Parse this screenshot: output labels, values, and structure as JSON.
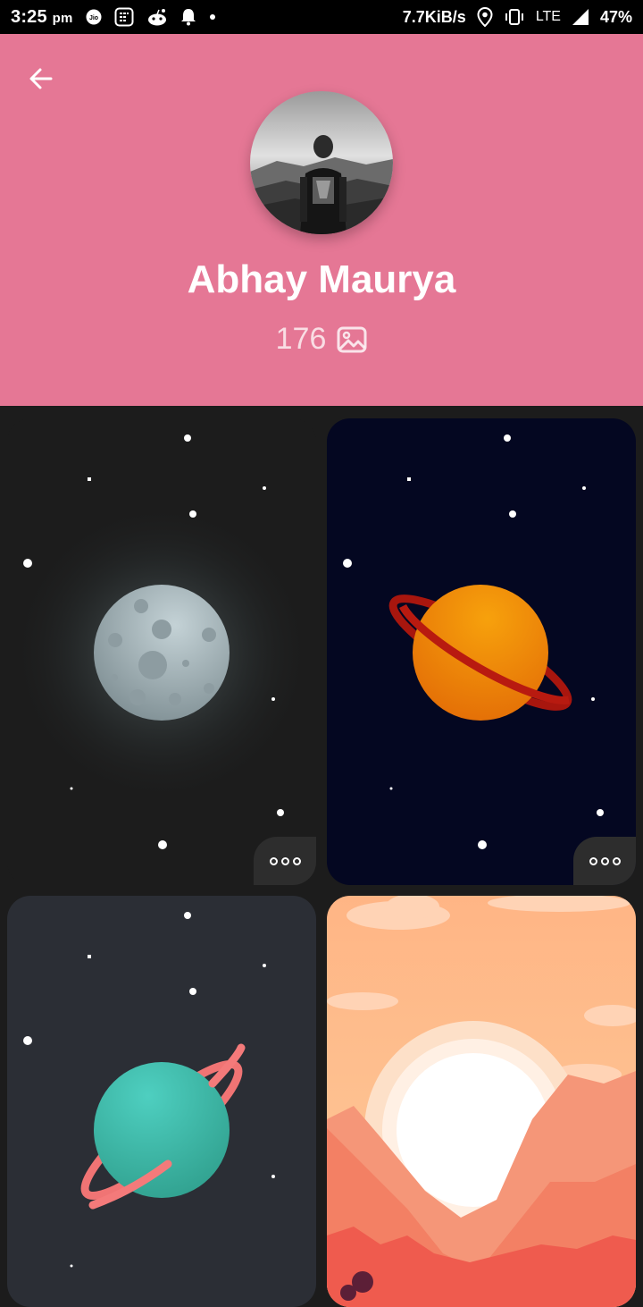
{
  "status_bar": {
    "time": "3:25",
    "ampm": "pm",
    "net_speed": "7.7KiB/s",
    "network": "LTE",
    "battery": "47%"
  },
  "profile": {
    "name": "Abhay Maurya",
    "photo_count": "176"
  },
  "icons": {
    "back": "arrow-left-icon",
    "photos": "image-icon",
    "more": "more-dots-icon"
  },
  "colors": {
    "header_bg": "#e57795",
    "grid_bg": "#1c1c1c"
  },
  "wallpapers": [
    {
      "subject": "moon"
    },
    {
      "subject": "saturn-orange"
    },
    {
      "subject": "planet-teal"
    },
    {
      "subject": "sunset-mountains"
    }
  ]
}
